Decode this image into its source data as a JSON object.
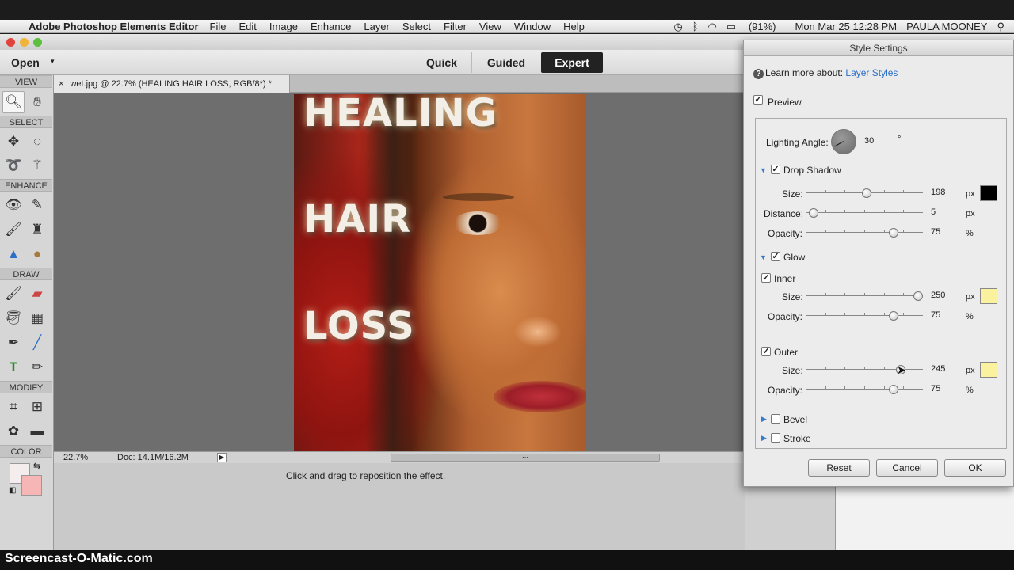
{
  "menubar": {
    "app_name": "Adobe Photoshop Elements Editor",
    "items": [
      "File",
      "Edit",
      "Image",
      "Enhance",
      "Layer",
      "Select",
      "Filter",
      "View",
      "Window",
      "Help"
    ],
    "battery": "(91%)",
    "datetime": "Mon Mar 25  12:28 PM",
    "user": "PAULA MOONEY"
  },
  "modebar": {
    "open_label": "Open",
    "modes": [
      "Quick",
      "Guided",
      "Expert"
    ],
    "active_mode": "Expert"
  },
  "toolbox": {
    "sections": [
      "VIEW",
      "SELECT",
      "ENHANCE",
      "DRAW",
      "MODIFY",
      "COLOR"
    ]
  },
  "document": {
    "tab_label": "wet.jpg @ 22.7% (HEALING   HAIR   LOSS, RGB/8*) *",
    "close_glyph": "×",
    "words": [
      "HEALING",
      "HAIR",
      "LOSS"
    ]
  },
  "statusbar": {
    "zoom": "22.7%",
    "doc_size": "Doc: 14.1M/16.2M"
  },
  "hint": "Click and drag to reposition the effect.",
  "dialog": {
    "title": "Style Settings",
    "learn_prefix": "Learn more about:",
    "learn_link": "Layer Styles",
    "preview_label": "Preview",
    "lighting_angle_label": "Lighting Angle:",
    "lighting_angle_value": "30",
    "degree_symbol": "°",
    "drop_shadow": {
      "label": "Drop Shadow",
      "size_label": "Size:",
      "size_value": "198",
      "size_unit": "px",
      "size_level": 0.52,
      "distance_label": "Distance:",
      "distance_value": "5",
      "distance_unit": "px",
      "distance_level": 0.07,
      "opacity_label": "Opacity:",
      "opacity_value": "75",
      "opacity_unit": "%",
      "opacity_level": 0.75,
      "color": "#000000"
    },
    "glow": {
      "label": "Glow",
      "inner": {
        "label": "Inner",
        "size_label": "Size:",
        "size_value": "250",
        "size_unit": "px",
        "size_level": 0.96,
        "opacity_label": "Opacity:",
        "opacity_value": "75",
        "opacity_unit": "%",
        "opacity_level": 0.75,
        "color": "#fbf2a0"
      },
      "outer": {
        "label": "Outer",
        "size_label": "Size:",
        "size_value": "245",
        "size_unit": "px",
        "size_level": 0.81,
        "opacity_label": "Opacity:",
        "opacity_value": "75",
        "opacity_unit": "%",
        "opacity_level": 0.75,
        "color": "#fbf2a0"
      }
    },
    "bevel_label": "Bevel",
    "stroke_label": "Stroke",
    "buttons": {
      "reset": "Reset",
      "cancel": "Cancel",
      "ok": "OK"
    }
  },
  "footer": "Screencast-O-Matic.com"
}
